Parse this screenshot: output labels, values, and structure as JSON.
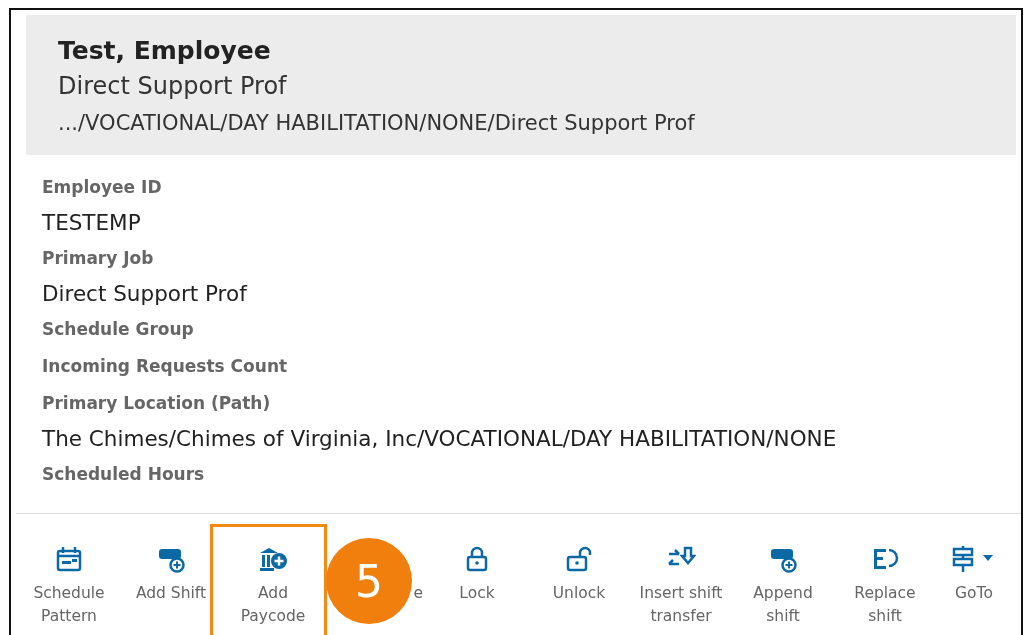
{
  "header": {
    "name": "Test, Employee",
    "job": "Direct Support Prof",
    "path": ".../VOCATIONAL/DAY HABILITATION/NONE/Direct Support Prof"
  },
  "fields": [
    {
      "label": "Employee ID",
      "value": "TESTEMP"
    },
    {
      "label": "Primary Job",
      "value": "Direct Support Prof"
    },
    {
      "label": "Schedule Group"
    },
    {
      "label": "Incoming Requests Count"
    },
    {
      "label": "Primary Location (Path)",
      "value": "The Chimes/Chimes of Virginia, Inc/VOCATIONAL/DAY HABILITATION/NONE"
    },
    {
      "label": "Scheduled Hours"
    }
  ],
  "toolbar": [
    {
      "kind": "schedule-pattern",
      "label": "Schedule Pattern",
      "highlighted": false
    },
    {
      "kind": "add-shift",
      "label": "Add Shift",
      "highlighted": false
    },
    {
      "kind": "add-paycode",
      "label": "Add Paycode",
      "highlighted": true
    },
    {
      "kind": "covered",
      "label": "e",
      "highlighted": false
    },
    {
      "kind": "lock",
      "label": "Lock",
      "highlighted": false
    },
    {
      "kind": "unlock",
      "label": "Unlock",
      "highlighted": false
    },
    {
      "kind": "transfer",
      "label": "Insert shift transfer",
      "highlighted": false
    },
    {
      "kind": "append",
      "label": "Append shift",
      "highlighted": false
    },
    {
      "kind": "replace",
      "label": "Replace shift",
      "highlighted": false
    },
    {
      "kind": "goto",
      "label": "GoTo",
      "highlighted": false
    }
  ],
  "callout": {
    "number": "5"
  }
}
